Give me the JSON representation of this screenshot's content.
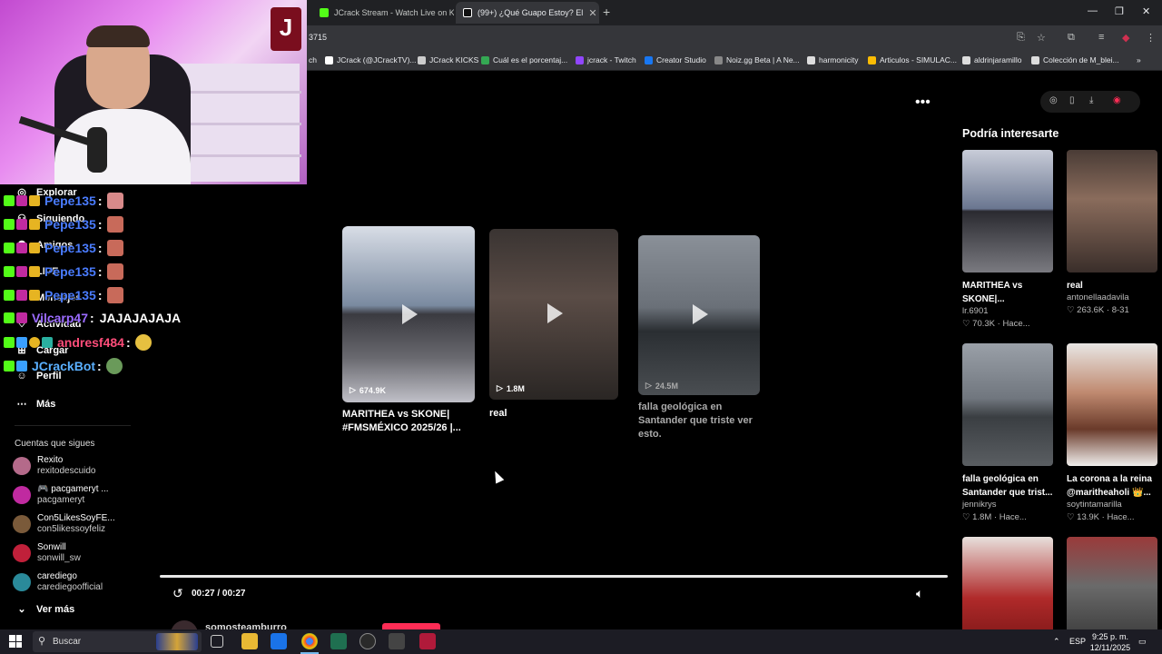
{
  "browser": {
    "tabs": [
      {
        "label": "JCrack Stream - Watch Live on K",
        "active": false
      },
      {
        "label": "(99+) ¿Qué Guapo Estoy? El",
        "active": true
      }
    ],
    "address": "3715",
    "bookmarks": [
      "ch",
      "JCrack (@JCrackTV)...",
      "JCrack KICKS",
      "Cuál es el porcentaj...",
      "jcrack - Twitch",
      "Creator Studio",
      "Noiz.gg Beta | A Ne...",
      "harmonicity",
      "Articulos - SIMULAC...",
      "aldrinjaramillo",
      "Colección de M_blei..."
    ]
  },
  "sidebar": {
    "nav": [
      "Explorar",
      "Siguiendo",
      "Amigos",
      "LIVE",
      "Mensajes",
      "Actividad",
      "Cargar",
      "Perfil",
      "Más"
    ],
    "following_header": "Cuentas que sigues",
    "following": [
      {
        "name": "Rexito",
        "user": "rexitodescuido",
        "color": "#b46a8a"
      },
      {
        "name": "🎮 pacgameryt ...",
        "user": "pacgameryt",
        "color": "#c02aa0"
      },
      {
        "name": "Con5LikesSoyFE...",
        "user": "con5likessoyfeliz",
        "color": "#7a5a3a"
      },
      {
        "name": "Sonwill",
        "user": "sonwill_sw",
        "color": "#c0203a"
      },
      {
        "name": "carediego",
        "user": "carediegoofficial",
        "color": "#2a8a9a"
      }
    ],
    "more_label": "Ver más"
  },
  "chat": [
    {
      "user": "Pepe135",
      "sep": ":",
      "msg": "",
      "color": "#4a7cff",
      "emote": true
    },
    {
      "user": "Pepe135",
      "sep": ":",
      "msg": "",
      "color": "#4a7cff",
      "emote": true
    },
    {
      "user": "Pepe135",
      "sep": ":",
      "msg": "",
      "color": "#4a7cff",
      "emote": true
    },
    {
      "user": "Pepe135",
      "sep": ":",
      "msg": "",
      "color": "#4a7cff",
      "emote": true
    },
    {
      "user": "Pepe135",
      "sep": ":",
      "msg": "",
      "color": "#4a7cff",
      "emote": true
    },
    {
      "user": "Vilcarp47",
      "sep": ":",
      "msg": "JAJAJAJAJA",
      "color": "#9b6bff",
      "emote": false
    },
    {
      "user": "andresf484",
      "sep": ":",
      "msg": "",
      "color": "#ff4d7a",
      "emote": true
    },
    {
      "user": "JCrackBot",
      "sep": ":",
      "msg": "",
      "color": "#5ab0ff",
      "emote": true
    }
  ],
  "main": {
    "cards": [
      {
        "title": "MARITHEA vs SKONE| #FMSMÉXICO 2025/26 |...",
        "views": "674.9K"
      },
      {
        "title": "real",
        "views": "1.8M"
      },
      {
        "title": "falla geológica en Santander que triste ver esto.",
        "views": "24.5M"
      }
    ],
    "time": "00:27 / 00:27",
    "progress": 1.0,
    "author": "somosteamburro"
  },
  "right_panel": {
    "header": "Podría interesarte",
    "items": [
      {
        "title": "MARITHEA vs SKONE|...",
        "author": "lr.6901",
        "likes": "70.3K",
        "when": "Hace..."
      },
      {
        "title": "real",
        "author": "antonellaadavila",
        "likes": "263.6K",
        "when": "8-31"
      },
      {
        "title": "falla geológica en Santander que trist...",
        "author": "jennikrys",
        "likes": "1.8M",
        "when": "Hace..."
      },
      {
        "title": "La corona a la reina @maritheaholi 👑...",
        "author": "soytintamarilla",
        "likes": "13.9K",
        "when": "Hace..."
      }
    ]
  },
  "taskbar": {
    "search": "Buscar",
    "lang": "ESP",
    "time": "9:25 p. m.",
    "date": "12/11/2025"
  }
}
